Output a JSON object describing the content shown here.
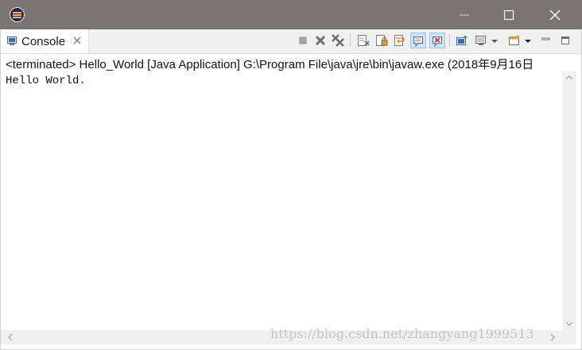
{
  "window": {
    "app_icon": "eclipse-icon",
    "controls": [
      "minimize-icon",
      "maximize-icon",
      "close-icon"
    ]
  },
  "console_view": {
    "tab_label": "Console",
    "tab_icon": "console-icon",
    "toolbar_icons": [
      "terminate-icon",
      "remove-launch-icon",
      "remove-all-terminated-icon",
      "clear-console-icon",
      "scroll-lock-icon",
      "word-wrap-icon",
      "show-on-stdout-icon",
      "show-on-stderr-icon",
      "pin-console-icon",
      "display-selected-console-icon",
      "open-console-icon",
      "minimize-view-icon",
      "maximize-view-icon"
    ],
    "status": "<terminated> Hello_World [Java Application] G:\\Program File\\java\\jre\\bin\\javaw.exe (2018年9月16日",
    "output": "Hello World."
  },
  "watermark": "https://blog.csdn.net/zhangyang1999513",
  "colors": {
    "titlebar": "#7a7472",
    "tab_strip": "#f0f0f0",
    "toolbar_active": "#cde4f7"
  }
}
